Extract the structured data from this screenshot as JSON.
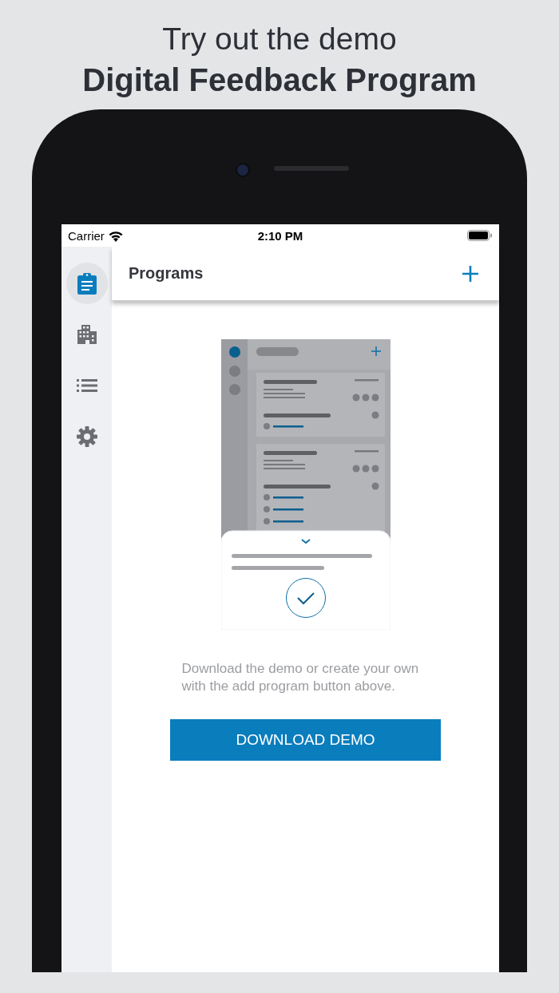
{
  "headline": {
    "line_1": "Try out the demo",
    "line_2": "Digital Feedback Program"
  },
  "status_bar": {
    "carrier": "Carrier",
    "time": "2:10 PM"
  },
  "sidebar": {
    "items": [
      {
        "kind": "programs",
        "selected": true
      },
      {
        "kind": "buildings",
        "selected": false
      },
      {
        "kind": "list",
        "selected": false
      },
      {
        "kind": "settings",
        "selected": false
      }
    ]
  },
  "header": {
    "title": "Programs"
  },
  "empty_state": {
    "message": "Download the demo or create your own with the add program button above.",
    "button": "DOWNLOAD DEMO"
  }
}
